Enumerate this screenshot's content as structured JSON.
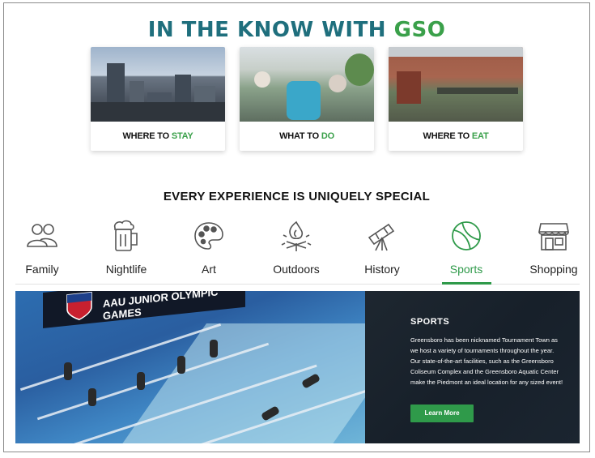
{
  "header": {
    "title_prefix": "IN THE KNOW WITH ",
    "title_accent": "GSO"
  },
  "cards": [
    {
      "label_prefix": "WHERE TO ",
      "label_accent": "STAY"
    },
    {
      "label_prefix": "WHAT TO ",
      "label_accent": "DO"
    },
    {
      "label_prefix": "WHERE TO ",
      "label_accent": "EAT"
    }
  ],
  "section": {
    "subtitle": "EVERY EXPERIENCE IS UNIQUELY SPECIAL"
  },
  "categories": [
    {
      "label": "Family",
      "icon": "family-icon",
      "active": false
    },
    {
      "label": "Nightlife",
      "icon": "beer-mug-icon",
      "active": false
    },
    {
      "label": "Art",
      "icon": "palette-icon",
      "active": false
    },
    {
      "label": "Outdoors",
      "icon": "campfire-icon",
      "active": false
    },
    {
      "label": "History",
      "icon": "telescope-icon",
      "active": false
    },
    {
      "label": "Sports",
      "icon": "ball-icon",
      "active": true
    },
    {
      "label": "Shopping",
      "icon": "storefront-icon",
      "active": false
    }
  ],
  "hero": {
    "banner_text": "AAU JUNIOR OLYMPIC GAMES",
    "panel_title": "SPORTS",
    "panel_body": "Greensboro has been nicknamed Tournament Town as we host a variety of tournaments throughout the year. Our state-of-the-art facilities, such as the Greensboro Coliseum Complex and the Greensboro Aquatic Center make the Piedmont an ideal location for any sized event!",
    "button_label": "Learn More"
  },
  "colors": {
    "teal": "#1f6f7d",
    "green": "#3aa04a",
    "panel_bg": "#17202a"
  }
}
